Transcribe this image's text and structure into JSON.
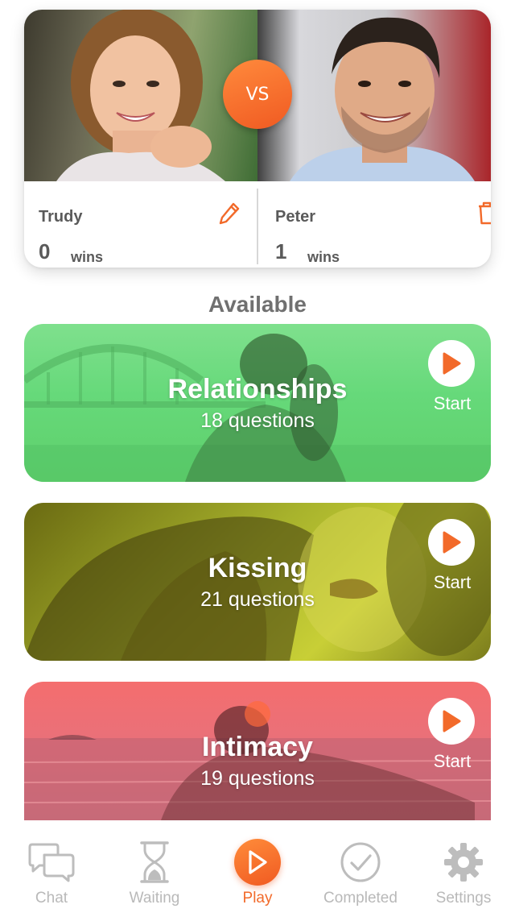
{
  "versus": {
    "badge": "VS",
    "player1": {
      "name": "Trudy",
      "wins": "0",
      "wins_label": "wins",
      "action_icon": "pencil-icon"
    },
    "player2": {
      "name": "Peter",
      "wins": "1",
      "wins_label": "wins",
      "action_icon": "trash-icon"
    }
  },
  "section_heading": "Available",
  "topics": [
    {
      "title": "Relationships",
      "count": "18 questions",
      "start_label": "Start",
      "tint": "#66d97a"
    },
    {
      "title": "Kissing",
      "count": "21 questions",
      "start_label": "Start",
      "tint": "#b3bd2f"
    },
    {
      "title": "Intimacy",
      "count": "19 questions",
      "start_label": "Start",
      "tint": "#ef6f74"
    }
  ],
  "nav": {
    "items": [
      {
        "label": "Chat",
        "icon": "chat-icon"
      },
      {
        "label": "Waiting",
        "icon": "hourglass-icon"
      },
      {
        "label": "Play",
        "icon": "play-icon",
        "active": true
      },
      {
        "label": "Completed",
        "icon": "check-circle-icon"
      },
      {
        "label": "Settings",
        "icon": "gear-icon"
      }
    ]
  },
  "colors": {
    "accent": "#f26a2a",
    "text_gray": "#5a5a5a",
    "inactive_gray": "#b9b9b9"
  }
}
